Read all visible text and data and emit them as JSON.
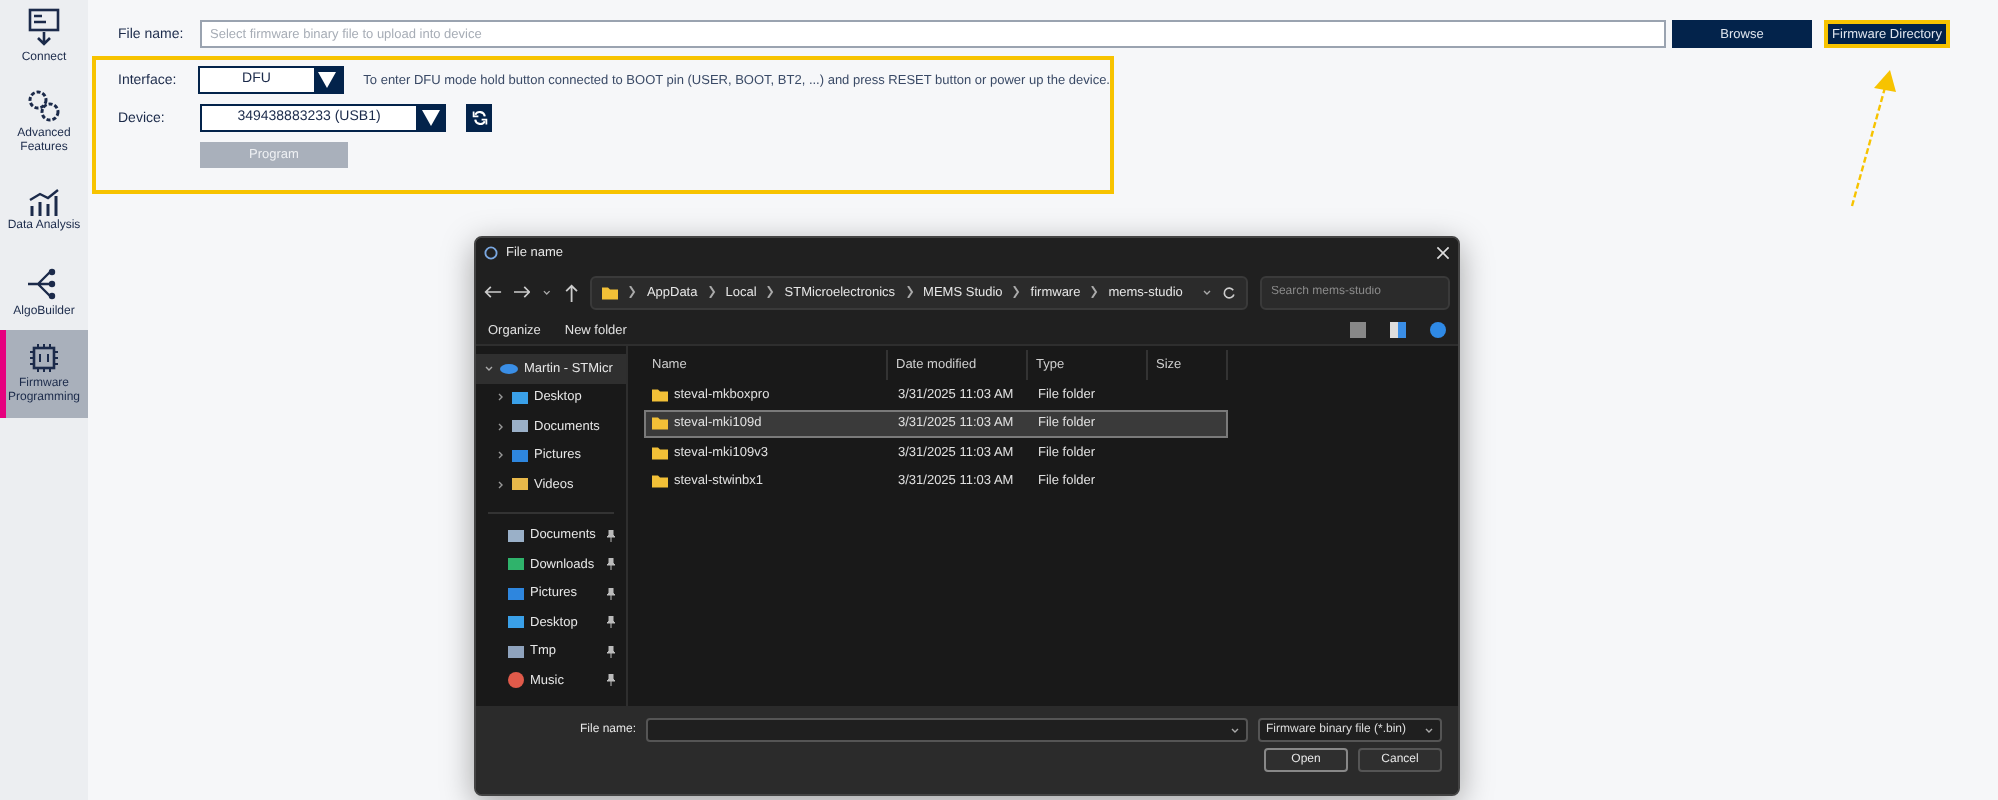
{
  "sidebar": {
    "items": [
      {
        "label": "Connect",
        "selected": false
      },
      {
        "label": "Advanced Features",
        "selected": false
      },
      {
        "label": "Data Analysis",
        "selected": false
      },
      {
        "label": "AlgoBuilder",
        "selected": false
      },
      {
        "label": "Firmware Programming",
        "selected": true
      }
    ]
  },
  "file_row": {
    "label": "File name:",
    "placeholder": "Select firmware binary file to upload into device",
    "buttons": [
      {
        "label": "Browse",
        "highlighted": false
      },
      {
        "label": "Firmware Directory",
        "highlighted": true
      }
    ]
  },
  "form": {
    "highlighted": true,
    "interface": {
      "label": "Interface:",
      "value": "DFU",
      "hint": "To enter DFU mode hold button connected to BOOT pin (USER, BOOT, BT2, ...) and press RESET button or power up the device."
    },
    "device": {
      "label": "Device:",
      "value": "349438883233 (USB1)"
    },
    "program_button": {
      "label": "Program",
      "disabled": true
    }
  },
  "dialog": {
    "title": "File name",
    "breadcrumb": [
      "AppData",
      "Local",
      "STMicroelectronics",
      "MEMS Studio",
      "firmware",
      "mems-studio"
    ],
    "search": {
      "placeholder": "Search mems-studio"
    },
    "toolbar": [
      "Organize",
      "New folder"
    ],
    "nav_pane": [
      {
        "label": "Martin - STMicr",
        "selected": true,
        "expanded": true,
        "children": [
          {
            "label": "Desktop",
            "selected": false,
            "expanded": false
          },
          {
            "label": "Documents",
            "selected": false,
            "expanded": false
          },
          {
            "label": "Pictures",
            "selected": false,
            "expanded": false
          },
          {
            "label": "Videos",
            "selected": false,
            "expanded": false
          }
        ]
      }
    ],
    "quick_access": [
      {
        "label": "Documents",
        "pinned": true
      },
      {
        "label": "Downloads",
        "pinned": true
      },
      {
        "label": "Pictures",
        "pinned": true
      },
      {
        "label": "Desktop",
        "pinned": true
      },
      {
        "label": "Tmp",
        "pinned": true
      },
      {
        "label": "Music",
        "pinned": true
      }
    ],
    "columns": [
      "Name",
      "Date modified",
      "Type",
      "Size"
    ],
    "rows": [
      {
        "name": "steval-mkboxpro",
        "date": "3/31/2025 11:03 AM",
        "type": "File folder",
        "selected": false
      },
      {
        "name": "steval-mki109d",
        "date": "3/31/2025 11:03 AM",
        "type": "File folder",
        "selected": true
      },
      {
        "name": "steval-mki109v3",
        "date": "3/31/2025 11:03 AM",
        "type": "File folder",
        "selected": false
      },
      {
        "name": "steval-stwinbx1",
        "date": "3/31/2025 11:03 AM",
        "type": "File folder",
        "selected": false
      }
    ],
    "footer": {
      "file_name_label": "File name:",
      "file_type": "Firmware binary file (*.bin)",
      "buttons": [
        "Open",
        "Cancel"
      ]
    }
  }
}
